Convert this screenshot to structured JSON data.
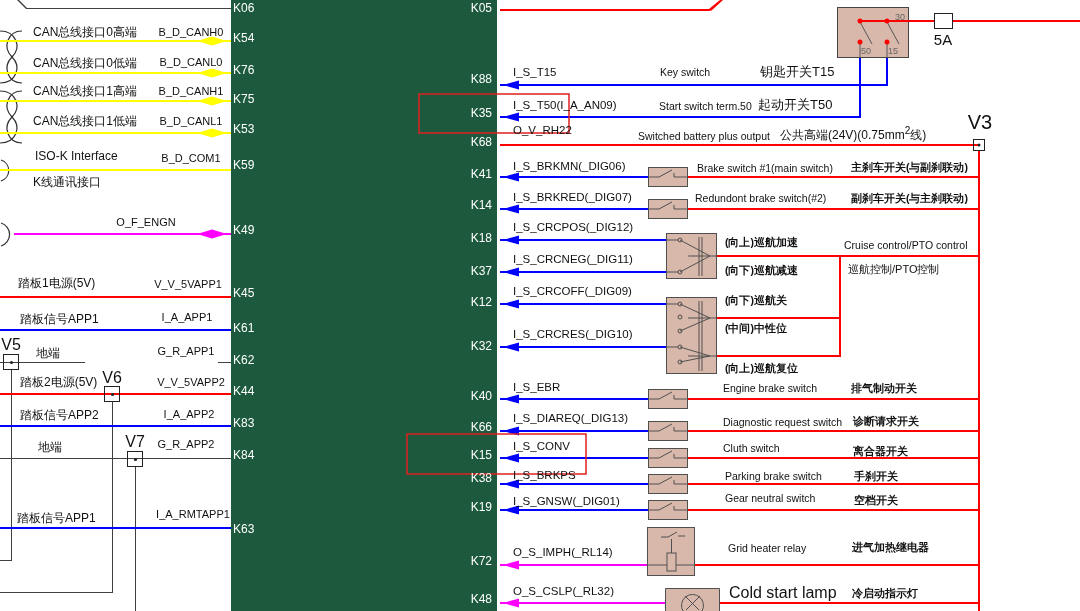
{
  "left_circuits": [
    {
      "pin": "K06",
      "kind": "plain",
      "color": "#404040"
    },
    {
      "pin": "K54",
      "kind": "bus",
      "color": "#ffff00",
      "label": "CAN总线接口0高端",
      "signal": "B_D_CANH0"
    },
    {
      "pin": "K76",
      "kind": "bus",
      "color": "#ffff00",
      "label": "CAN总线接口0低端",
      "signal": "B_D_CANL0"
    },
    {
      "pin": "K75",
      "kind": "bus",
      "color": "#ffff00",
      "label": "CAN总线接口1高端",
      "signal": "B_D_CANH1"
    },
    {
      "pin": "K53",
      "kind": "bus",
      "color": "#ffff00",
      "label": "CAN总线接口1低端",
      "signal": "B_D_CANL1"
    },
    {
      "pin": "K59",
      "kind": "plain",
      "color": "#ffff00",
      "label": "ISO-K Interface",
      "label_2": "K线通讯接口",
      "signal": "B_D_COM1"
    },
    {
      "pin": "K49",
      "kind": "bus",
      "color": "#ff00ff",
      "signal": "O_F_ENGN"
    },
    {
      "pin": "K45",
      "kind": "plain",
      "color": "#ff0000",
      "label": "踏板1电源(5V)",
      "signal": "V_V_5VAPP1"
    },
    {
      "pin": "K61",
      "kind": "plain",
      "color": "#0000ff",
      "label": "踏板信号APP1",
      "signal": "I_A_APP1"
    },
    {
      "pin": "K62",
      "kind": "plain",
      "color": "#404040",
      "label": "地端",
      "signal": "G_R_APP1",
      "splice": "V5"
    },
    {
      "pin": "K44",
      "kind": "plain",
      "color": "#ff0000",
      "label": "踏板2电源(5V)",
      "signal": "V_V_5VAPP2",
      "splice": "V6"
    },
    {
      "pin": "K83",
      "kind": "plain",
      "color": "#0000ff",
      "label": "踏板信号APP2",
      "signal": "I_A_APP2"
    },
    {
      "pin": "K84",
      "kind": "plain",
      "color": "#404040",
      "label": "地端",
      "signal": "G_R_APP2",
      "splice": "V7"
    },
    {
      "pin": "K63",
      "kind": "plain",
      "color": "#0000ff",
      "label": "踏板信号APP1",
      "signal": "I_A_RMTAPP1"
    }
  ],
  "right_circuits": [
    {
      "pin": "K05",
      "kind": "supply",
      "color": "#ff0000",
      "highlighted": false
    },
    {
      "pin": "K88",
      "kind": "input",
      "color": "#0000ff",
      "signal": "I_S_T15",
      "description": "Key switch",
      "description_cn": "钥匙开关T15",
      "highlighted": false
    },
    {
      "pin": "K35",
      "kind": "input",
      "color": "#0000ff",
      "signal": "I_S_T50(I_A_AN09)",
      "description": "Start switch term.50",
      "description_cn": "起动开关T50",
      "highlighted": true
    },
    {
      "pin": "K68",
      "kind": "supply",
      "color": "#ff0000",
      "signal": "O_V_RH22",
      "description": "Switched battery plus output",
      "description_cn": "公共高端(24V)(0.75mm$^{2}$线)",
      "splice": "V3",
      "highlighted": false
    },
    {
      "pin": "K41",
      "kind": "input",
      "color": "#0000ff",
      "signal": "I_S_BRKMN(_DIG06)",
      "device": {
        "kind": "switch"
      },
      "description": "Brake switch #1(main switch)",
      "description_cn": "主刹车开关(与副刹联动)",
      "highlighted": false
    },
    {
      "pin": "K14",
      "kind": "input",
      "color": "#0000ff",
      "signal": "I_S_BRKRED(_DIG07)",
      "device": {
        "kind": "switch"
      },
      "description": "Redundont brake switch(#2)",
      "description_cn": "副刹车开关(与主刹联动)",
      "highlighted": false
    },
    {
      "pin": "K18",
      "kind": "input",
      "color": "#0000ff",
      "signal": "I_S_CRCPOS(_DIG12)",
      "highlighted": false
    },
    {
      "pin": "K37",
      "kind": "input",
      "color": "#0000ff",
      "signal": "I_S_CRCNEG(_DIG11)",
      "highlighted": false
    },
    {
      "pin": "K12",
      "kind": "input",
      "color": "#0000ff",
      "signal": "I_S_CRCOFF(_DIG09)",
      "highlighted": false
    },
    {
      "pin": "K32",
      "kind": "input",
      "color": "#0000ff",
      "signal": "I_S_CRCRES(_DIG10)",
      "highlighted": false
    },
    {
      "pin": "K40",
      "kind": "input",
      "color": "#0000ff",
      "signal": "I_S_EBR",
      "device": {
        "kind": "switch"
      },
      "description": "Engine brake switch",
      "description_cn": "排气制动开关",
      "highlighted": false
    },
    {
      "pin": "K66",
      "kind": "input",
      "color": "#0000ff",
      "signal": "I_S_DIAREQ(_DIG13)",
      "device": {
        "kind": "switch"
      },
      "description": "Diagnostic request switch",
      "description_cn": "诊断请求开关",
      "highlighted": false
    },
    {
      "pin": "K15",
      "kind": "input",
      "color": "#0000ff",
      "signal": "I_S_CONV",
      "device": {
        "kind": "switch"
      },
      "description": "Cluth switch",
      "description_cn": "离合器开关",
      "highlighted": true
    },
    {
      "pin": "K38",
      "kind": "input",
      "color": "#0000ff",
      "signal": "I_S_BRKPS",
      "device": {
        "kind": "switch"
      },
      "description": "Parking brake switch",
      "description_cn": "手刹开关",
      "highlighted": false
    },
    {
      "pin": "K19",
      "kind": "input",
      "color": "#0000ff",
      "signal": "I_S_GNSW(_DIG01)",
      "device": {
        "kind": "switch"
      },
      "description": "Gear neutral switch",
      "description_cn": "空档开关",
      "highlighted": false
    },
    {
      "pin": "K72",
      "kind": "output",
      "color": "#ff00ff",
      "signal": "O_S_IMPH(_RL14)",
      "device": {
        "kind": "relay"
      },
      "description": "Grid heater relay",
      "description_cn": "进气加热继电器",
      "highlighted": false
    },
    {
      "pin": "K48",
      "kind": "output",
      "color": "#ff00ff",
      "signal": "O_S_CSLP(_RL32)",
      "device": {
        "kind": "lamp"
      },
      "description": "Cold start lamp",
      "description_cn": "冷启动指示灯",
      "highlighted": false
    }
  ],
  "ignition_switch": {
    "terminals": [
      "30",
      "50",
      "15"
    ],
    "fuse": "5A"
  },
  "cruise_control": {
    "title": "Cruise control/PTO control",
    "title_cn": "巡航控制/PTO控制",
    "switches": [
      {
        "positions": [
          "(向上)巡航加速",
          "(向下)巡航减速"
        ]
      },
      {
        "positions": [
          "(向下)巡航关",
          "(中间)中性位",
          "(向上)巡航复位"
        ]
      }
    ]
  }
}
